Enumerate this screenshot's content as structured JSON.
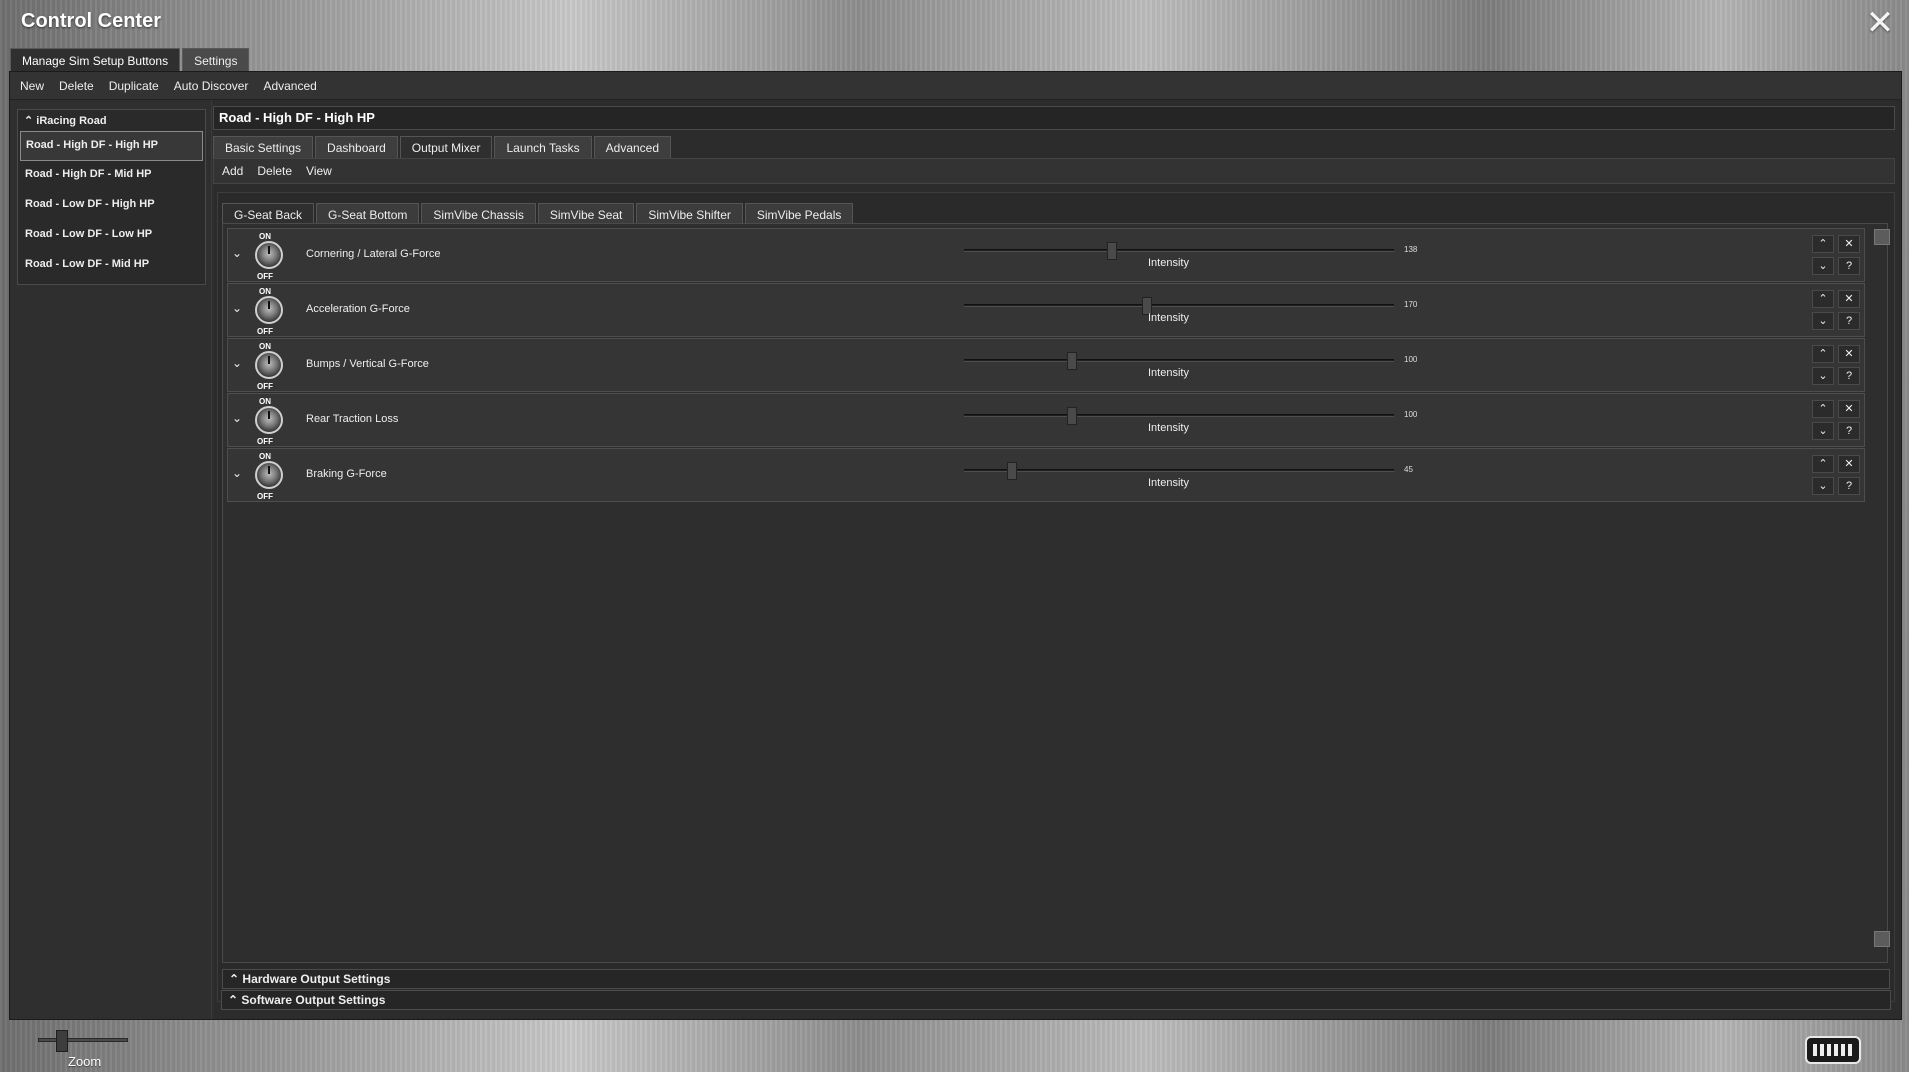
{
  "app": {
    "title": "Control Center"
  },
  "top_tabs": [
    {
      "label": "Manage Sim Setup Buttons",
      "active": true
    },
    {
      "label": "Settings",
      "active": false
    }
  ],
  "menu": [
    "New",
    "Delete",
    "Duplicate",
    "Auto Discover",
    "Advanced"
  ],
  "sidebar": {
    "group_label": "iRacing Road",
    "items": [
      {
        "label": "Road - High DF - High HP",
        "selected": true
      },
      {
        "label": "Road - High DF - Mid HP",
        "selected": false
      },
      {
        "label": "Road - Low DF - High HP",
        "selected": false
      },
      {
        "label": "Road - Low DF - Low HP",
        "selected": false
      },
      {
        "label": "Road - Low DF - Mid HP",
        "selected": false
      }
    ]
  },
  "setup": {
    "title": "Road - High DF - High HP",
    "tabs": [
      {
        "label": "Basic Settings",
        "active": false
      },
      {
        "label": "Dashboard",
        "active": false
      },
      {
        "label": "Output Mixer",
        "active": true
      },
      {
        "label": "Launch Tasks",
        "active": false
      },
      {
        "label": "Advanced",
        "active": false
      }
    ],
    "submenu": [
      "Add",
      "Delete",
      "View"
    ]
  },
  "channel_tabs": [
    {
      "label": "G-Seat Back",
      "active": true
    },
    {
      "label": "G-Seat Bottom",
      "active": false
    },
    {
      "label": "SimVibe Chassis",
      "active": false
    },
    {
      "label": "SimVibe Seat",
      "active": false
    },
    {
      "label": "SimVibe Shifter",
      "active": false
    },
    {
      "label": "SimVibe Pedals",
      "active": false
    }
  ],
  "effects": [
    {
      "name": "Cornering / Lateral G-Force",
      "intensity": 138,
      "on_label": "ON",
      "off_label": "OFF",
      "slider_label": "Intensity"
    },
    {
      "name": "Acceleration G-Force",
      "intensity": 170,
      "on_label": "ON",
      "off_label": "OFF",
      "slider_label": "Intensity"
    },
    {
      "name": "Bumps / Vertical G-Force",
      "intensity": 100,
      "on_label": "ON",
      "off_label": "OFF",
      "slider_label": "Intensity"
    },
    {
      "name": "Rear Traction Loss",
      "intensity": 100,
      "on_label": "ON",
      "off_label": "OFF",
      "slider_label": "Intensity"
    },
    {
      "name": "Braking G-Force",
      "intensity": 45,
      "on_label": "ON",
      "off_label": "OFF",
      "slider_label": "Intensity"
    }
  ],
  "slider_max": 400,
  "row_buttons": {
    "up": "⌃",
    "down": "⌄",
    "remove": "✕",
    "help": "?"
  },
  "sections": [
    {
      "label": "Hardware Output Settings"
    },
    {
      "label": "Software Output Settings"
    }
  ],
  "zoom": {
    "label": "Zoom",
    "value": 0.2
  },
  "colors": {
    "panel_bg": "#2f2f2f",
    "text": "#e6e6e6",
    "highlight_border": "#8a8a8a"
  }
}
